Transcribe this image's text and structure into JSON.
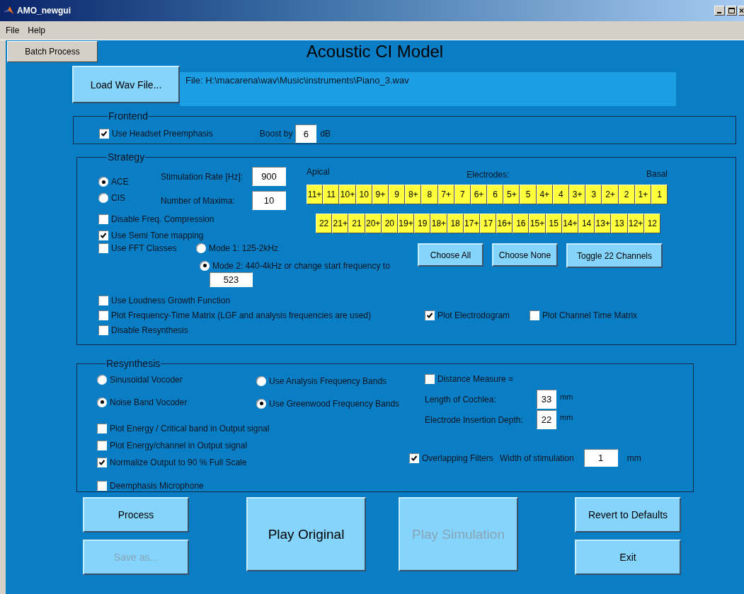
{
  "window": {
    "title": "AMO_newgui"
  },
  "menu": [
    {
      "label": "File"
    },
    {
      "label": "Help"
    }
  ],
  "batch_button": "Batch Process",
  "heading": "Acoustic CI Model",
  "load_button": "Load Wav File...",
  "file_path": "File: H:\\macarena\\wav\\Music\\instruments\\Piano_3.wav",
  "frontend": {
    "title": "Frontend",
    "preemphasis": {
      "label": "Use Headset Preemphasis",
      "checked": true
    },
    "boost_label": "Boost by",
    "boost_value": "6",
    "boost_unit": "dB"
  },
  "strategy": {
    "title": "Strategy",
    "modes": [
      {
        "label": "ACE",
        "selected": true
      },
      {
        "label": "CIS",
        "selected": false
      }
    ],
    "stim_rate": {
      "label": "Stimulation Rate [Hz]:",
      "value": "900"
    },
    "maxima": {
      "label": "Number of Maxima:",
      "value": "10"
    },
    "disable_compression": {
      "label": "Disable Freq. Compression",
      "checked": false
    },
    "semitone": {
      "label": "Use Semi Tone mapping",
      "checked": true
    },
    "fft_classes": {
      "label": "Use FFT Classes",
      "checked": false
    },
    "fft_modes": [
      {
        "label": "Mode 1: 125-2kHz",
        "selected": false
      },
      {
        "label": "Mode 2: 440-4kHz or change start frequency to",
        "selected": true
      }
    ],
    "start_frequency": "523",
    "loudness": {
      "label": "Use Loudness Growth Function",
      "checked": false
    },
    "plot_ftm": {
      "label": "Plot Frequency-Time Matrix (LGF and analysis frequencies are used)",
      "checked": false
    },
    "plot_electrodogram": {
      "label": "Plot Electrodogram",
      "checked": true
    },
    "plot_channel_time": {
      "label": "Plot Channel Time Matrix",
      "checked": false
    },
    "disable_resynthesis": {
      "label": "Disable Resynthesis",
      "checked": false
    },
    "apical_label": "Apical",
    "electrodes_label": "Electrodes:",
    "basal_label": "Basal",
    "electrode_rows": [
      [
        {
          "label": "11+",
          "selected": true
        },
        {
          "label": "11",
          "selected": true
        },
        {
          "label": "10+",
          "selected": true
        },
        {
          "label": "10",
          "selected": true
        },
        {
          "label": "9+",
          "selected": true
        },
        {
          "label": "9",
          "selected": true
        },
        {
          "label": "8+",
          "selected": true
        },
        {
          "label": "8",
          "selected": true
        },
        {
          "label": "7+",
          "selected": true
        },
        {
          "label": "7",
          "selected": true
        },
        {
          "label": "6+",
          "selected": true
        },
        {
          "label": "6",
          "selected": true
        },
        {
          "label": "5+",
          "selected": true
        },
        {
          "label": "5",
          "selected": true
        },
        {
          "label": "4+",
          "selected": true
        },
        {
          "label": "4",
          "selected": true
        },
        {
          "label": "3+",
          "selected": true
        },
        {
          "label": "3",
          "selected": true
        },
        {
          "label": "2+",
          "selected": true
        },
        {
          "label": "2",
          "selected": true
        },
        {
          "label": "1+",
          "selected": true
        },
        {
          "label": "1",
          "selected": true
        }
      ],
      [
        {
          "label": "22",
          "selected": true
        },
        {
          "label": "21+",
          "selected": true
        },
        {
          "label": "21",
          "selected": true
        },
        {
          "label": "20+",
          "selected": true
        },
        {
          "label": "20",
          "selected": true
        },
        {
          "label": "19+",
          "selected": true
        },
        {
          "label": "19",
          "selected": true
        },
        {
          "label": "18+",
          "selected": true
        },
        {
          "label": "18",
          "selected": true
        },
        {
          "label": "17+",
          "selected": true
        },
        {
          "label": "17",
          "selected": true
        },
        {
          "label": "16+",
          "selected": true
        },
        {
          "label": "16",
          "selected": true
        },
        {
          "label": "15+",
          "selected": true
        },
        {
          "label": "15",
          "selected": true
        },
        {
          "label": "14+",
          "selected": true
        },
        {
          "label": "14",
          "selected": true
        },
        {
          "label": "13+",
          "selected": true
        },
        {
          "label": "13",
          "selected": true
        },
        {
          "label": "12+",
          "selected": true
        },
        {
          "label": "12",
          "selected": true
        }
      ]
    ],
    "choose_all": "Choose All",
    "choose_none": "Choose None",
    "toggle_channels": "Toggle 22 Channels"
  },
  "resynthesis": {
    "title": "Resynthesis",
    "vocoders": [
      {
        "label": "Sinusoidal Vocoder",
        "selected": false
      },
      {
        "label": "Noise Band Vocoder",
        "selected": true
      }
    ],
    "bands": [
      {
        "label": "Use Analysis Frequency Bands",
        "selected": false
      },
      {
        "label": "Use Greenwood Frequency Bands",
        "selected": true
      }
    ],
    "plot_energy_critical": {
      "label": "Plot Energy / Critical band in Output signal",
      "checked": false
    },
    "plot_energy_channel": {
      "label": "Plot Energy/channel in Output signal",
      "checked": false
    },
    "normalize": {
      "label": "Normalize Output to 90 % Full Scale",
      "checked": true
    },
    "deemphasis": {
      "label": "Deemphasis Microphone",
      "checked": false
    },
    "distance": {
      "label": "Distance Measure =",
      "checked": false
    },
    "cochlea": {
      "label": "Length of Cochlea:",
      "value": "33",
      "unit": "mm"
    },
    "depth": {
      "label": "Electrode Insertion Depth:",
      "value": "22",
      "unit": "mm"
    },
    "overlapping": {
      "label": "Overlapping Filters",
      "checked": true
    },
    "width": {
      "label": "Width of stimulation",
      "value": "1",
      "unit": "mm"
    }
  },
  "actions": {
    "process": {
      "label": "Process",
      "disabled": false
    },
    "save": {
      "label": "Save as...",
      "disabled": true
    },
    "play_original": {
      "label": "Play Original",
      "disabled": false
    },
    "play_simulation": {
      "label": "Play Simulation",
      "disabled": true
    },
    "revert": {
      "label": "Revert to Defaults",
      "disabled": false
    },
    "exit": {
      "label": "Exit",
      "disabled": false
    }
  }
}
